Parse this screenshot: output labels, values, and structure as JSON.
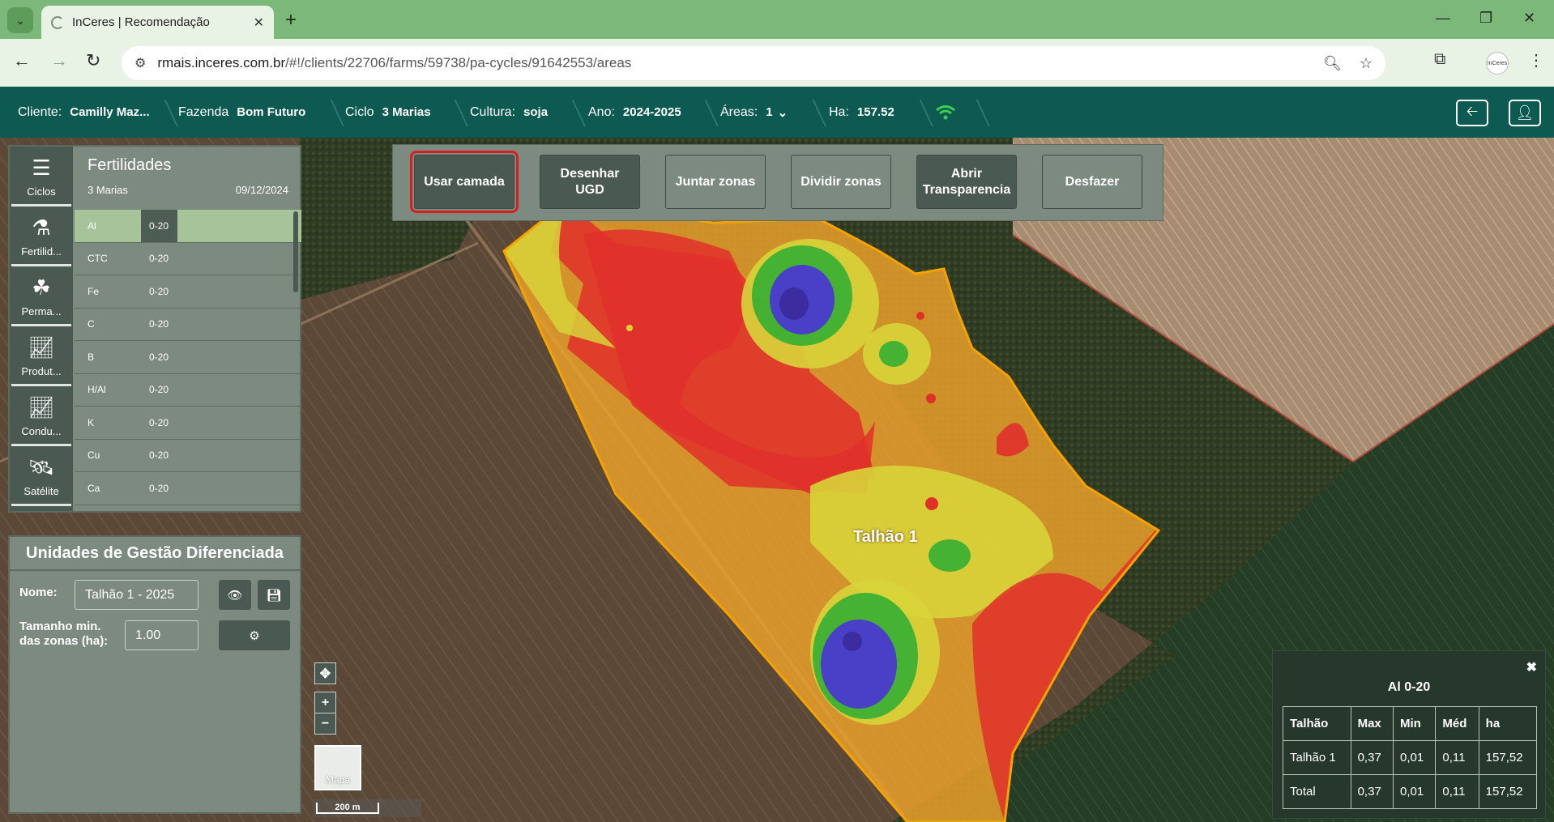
{
  "browser": {
    "tab_title": "InCeres | Recomendação",
    "url_host": "rmais.inceres.com.br",
    "url_path": "/#!/clients/22706/farms/59738/pa-cycles/91642553/areas"
  },
  "header": {
    "cliente_label": "Cliente:",
    "cliente_value": "Camilly Maz...",
    "fazenda_label": "Fazenda",
    "fazenda_value": "Bom Futuro",
    "ciclo_label": "Ciclo",
    "ciclo_value": "3 Marias",
    "cultura_label": "Cultura:",
    "cultura_value": "soja",
    "ano_label": "Ano:",
    "ano_value": "2024-2025",
    "areas_label": "Áreas:",
    "areas_value": "1",
    "ha_label": "Ha:",
    "ha_value": "157.52"
  },
  "nav": {
    "items": [
      {
        "label": "Ciclos",
        "icon": "list-icon"
      },
      {
        "label": "Fertilid...",
        "icon": "flask-icon"
      },
      {
        "label": "Perma...",
        "icon": "plants-icon"
      },
      {
        "label": "Produt...",
        "icon": "chart-line-icon"
      },
      {
        "label": "Condu...",
        "icon": "chart-line-icon"
      },
      {
        "label": "Satélite",
        "icon": "satellite-icon"
      }
    ]
  },
  "fertilidades": {
    "title": "Fertilidades",
    "subtitle": "3 Marias",
    "date": "09/12/2024",
    "rows": [
      {
        "name": "Al",
        "depth": "0-20"
      },
      {
        "name": "CTC",
        "depth": "0-20"
      },
      {
        "name": "Fe",
        "depth": "0-20"
      },
      {
        "name": "C",
        "depth": "0-20"
      },
      {
        "name": "B",
        "depth": "0-20"
      },
      {
        "name": "H/Al",
        "depth": "0-20"
      },
      {
        "name": "K",
        "depth": "0-20"
      },
      {
        "name": "Cu",
        "depth": "0-20"
      },
      {
        "name": "Ca",
        "depth": "0-20"
      }
    ]
  },
  "ugd": {
    "title": "Unidades de Gestão Diferenciada",
    "nome_label": "Nome:",
    "nome_value": "Talhão 1 - 2025",
    "tamanho_label_1": "Tamanho min.",
    "tamanho_label_2": "das zonas (ha):",
    "tamanho_value": "1.00"
  },
  "toolbar": {
    "usar_camada": "Usar camada",
    "desenhar_1": "Desenhar",
    "desenhar_2": "UGD",
    "juntar": "Juntar zonas",
    "dividir": "Dividir zonas",
    "abrir_1": "Abrir",
    "abrir_2": "Transparencia",
    "desfazer": "Desfazer"
  },
  "map": {
    "field_label": "Talhão 1",
    "toggle_label": "Mapa",
    "scale_label": "200 m"
  },
  "stats": {
    "title": "Al 0-20",
    "headers": [
      "Talhão",
      "Max",
      "Min",
      "Méd",
      "ha"
    ],
    "rows": [
      [
        "Talhão 1",
        "0,37",
        "0,01",
        "0,11",
        "157,52"
      ],
      [
        "Total",
        "0,37",
        "0,01",
        "0,11",
        "157,52"
      ]
    ]
  },
  "colors": {
    "header_bg": "#0d5a52",
    "panel_bg": "#7c8a80",
    "selected_row": "#a7c39a",
    "zone_red": "#e0302a",
    "zone_orange": "#eaa02a",
    "zone_yellow": "#d8d438",
    "zone_green": "#3db033",
    "zone_blue": "#4a3ad0"
  }
}
